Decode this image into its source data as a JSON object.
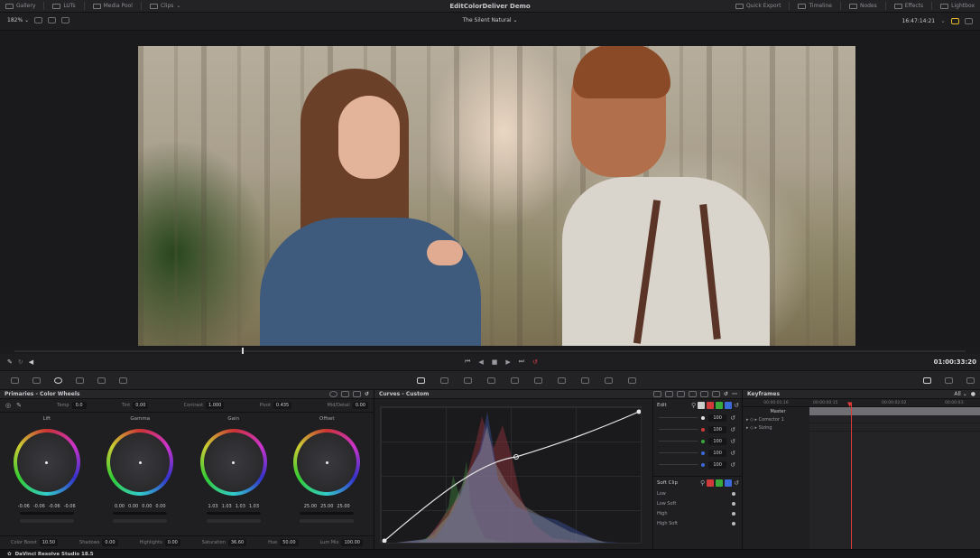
{
  "topbar": {
    "left_items": [
      "Gallery",
      "LUTs",
      "Media Pool",
      "Clips"
    ],
    "title": "EditColorDeliver Demo",
    "right_items": [
      "Quick Export",
      "Timeline",
      "Nodes",
      "Effects",
      "Lightbox"
    ]
  },
  "subbar": {
    "zoom": "182%",
    "clip_name": "The Silent Natural",
    "timecode": "16:47:14:21"
  },
  "transport": {
    "timecode": "01:00:33:20"
  },
  "primaries": {
    "title": "Primaries - Color Wheels",
    "top_fields": [
      {
        "label": "Temp",
        "value": "0.0"
      },
      {
        "label": "Tint",
        "value": "0.00"
      },
      {
        "label": "Contrast",
        "value": "1.000"
      },
      {
        "label": "Pivot",
        "value": "0.435"
      },
      {
        "label": "Mid/Detail",
        "value": "0.00"
      }
    ],
    "wheels": [
      {
        "label": "Lift",
        "values": [
          "-0.06",
          "-0.06",
          "-0.06",
          "-0.06"
        ]
      },
      {
        "label": "Gamma",
        "values": [
          "0.00",
          "0.00",
          "0.00",
          "0.00"
        ]
      },
      {
        "label": "Gain",
        "values": [
          "1.03",
          "1.03",
          "1.03",
          "1.03"
        ]
      },
      {
        "label": "Offset",
        "values": [
          "25.00",
          "25.00",
          "25.00"
        ]
      }
    ],
    "bottom_fields": [
      {
        "label": "Color Boost",
        "value": "10.50"
      },
      {
        "label": "Shadows",
        "value": "0.00"
      },
      {
        "label": "Highlights",
        "value": "0.00"
      },
      {
        "label": "Saturation",
        "value": "36.60"
      },
      {
        "label": "Hue",
        "value": "50.00"
      },
      {
        "label": "Lum Mix",
        "value": "100.00"
      }
    ]
  },
  "curves": {
    "title": "Curves - Custom",
    "edit_label": "Edit",
    "edit_values": [
      "100",
      "100",
      "100",
      "100",
      "100"
    ],
    "softclip_label": "Soft Clip",
    "softclip_rows": [
      "Low",
      "Low Soft",
      "High",
      "High Soft"
    ]
  },
  "keyframes": {
    "title": "Keyframes",
    "filter": "All",
    "timecodes": [
      "00:00:01:16",
      "00:00:00:15",
      "00:00:02:02",
      "00:00:03:"
    ],
    "rows": [
      "Master",
      "Corrector 1",
      "Sizing"
    ]
  },
  "status": {
    "app_name": "DaVinci Resolve Studio 18.5"
  }
}
